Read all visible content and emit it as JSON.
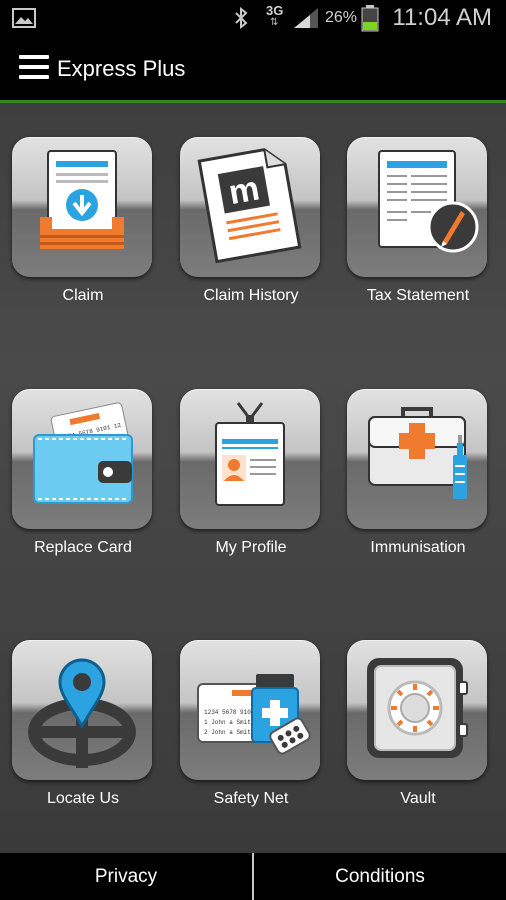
{
  "status_bar": {
    "network": "3G",
    "network_arrows": "⇅",
    "battery_percent": "26%",
    "time": "11:04 AM",
    "icons": [
      "gallery-icon",
      "bluetooth-icon",
      "signal-icon",
      "battery-icon"
    ]
  },
  "header": {
    "title": "Express Plus",
    "menu_icon": "hamburger-menu-icon"
  },
  "tiles": [
    {
      "label": "Claim",
      "icon": "claim-icon"
    },
    {
      "label": "Claim History",
      "icon": "claim-history-icon"
    },
    {
      "label": "Tax Statement",
      "icon": "tax-statement-icon"
    },
    {
      "label": "Replace Card",
      "icon": "replace-card-icon"
    },
    {
      "label": "My Profile",
      "icon": "my-profile-icon"
    },
    {
      "label": "Immunisation",
      "icon": "immunisation-icon"
    },
    {
      "label": "Locate Us",
      "icon": "locate-us-icon"
    },
    {
      "label": "Safety Net",
      "icon": "safety-net-icon"
    },
    {
      "label": "Vault",
      "icon": "vault-icon"
    }
  ],
  "icon_text": {
    "claim_history_letter": "m",
    "card_number": "1234 5678 9101 12",
    "safety_card_line1": "1234 5678 9101",
    "safety_card_line2": "1  John a Smith",
    "safety_card_line3": "2  John a Smith"
  },
  "footer": {
    "privacy": "Privacy",
    "conditions": "Conditions"
  },
  "colors": {
    "accent_green": "#2f8a1f",
    "icon_blue": "#2aa3e0",
    "icon_orange": "#f07a2e"
  }
}
